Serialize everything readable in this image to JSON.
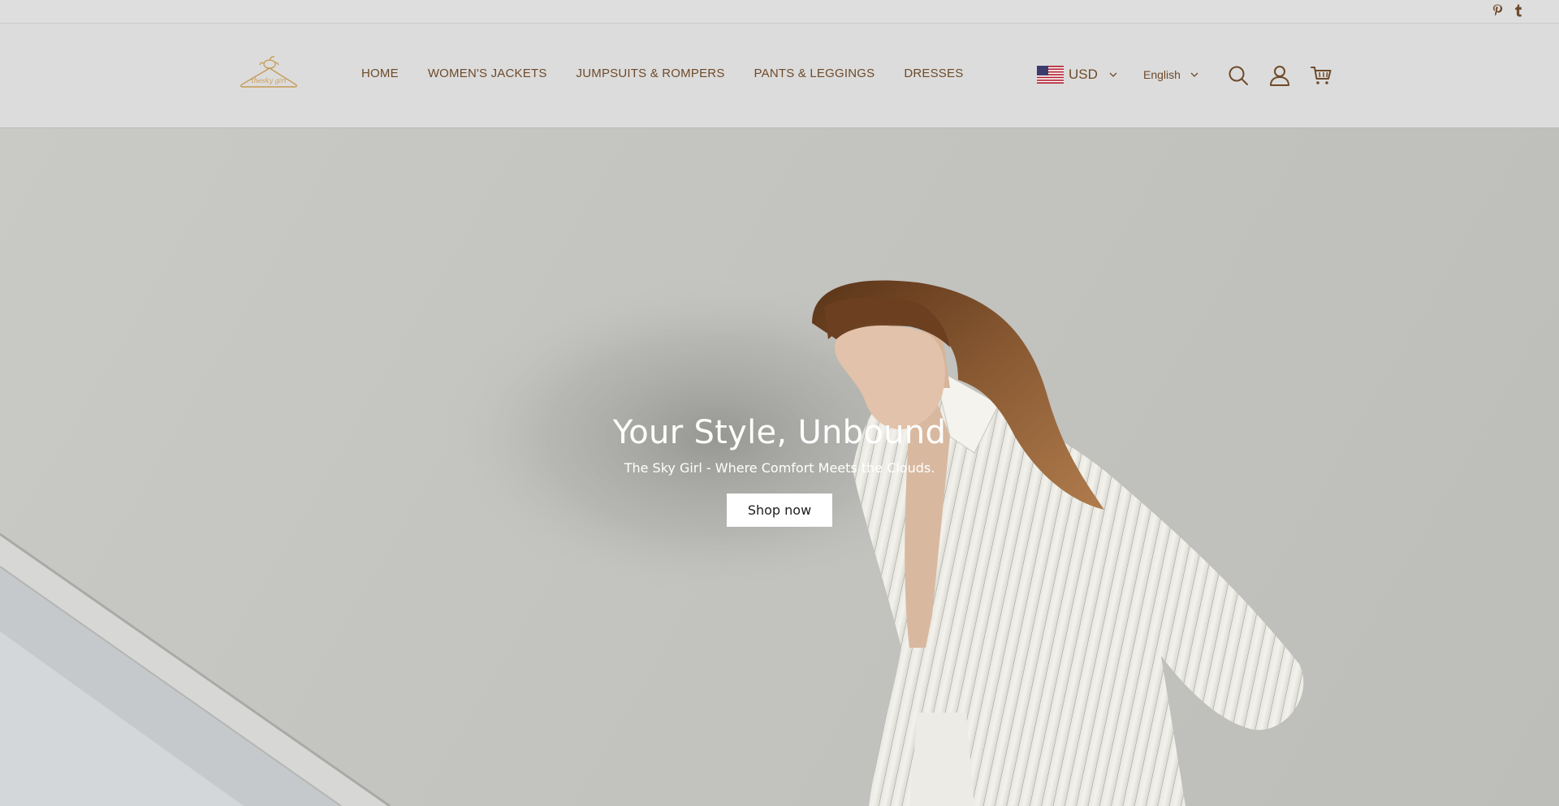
{
  "social": {
    "pinterest_icon": "pinterest-icon",
    "tumblr_icon": "tumblr-icon"
  },
  "header": {
    "logo_icon": "hanger-logo",
    "logo_text": "thesky girl",
    "nav": [
      {
        "label": "HOME"
      },
      {
        "label": "WOMEN'S JACKETS"
      },
      {
        "label": "JUMPSUITS & ROMPERS"
      },
      {
        "label": "PANTS & LEGGINGS"
      },
      {
        "label": "DRESSES"
      }
    ],
    "currency": {
      "label": "USD",
      "flag_icon": "us-flag-icon"
    },
    "language": {
      "label": "English"
    },
    "icons": [
      "search-icon",
      "account-icon",
      "cart-icon"
    ]
  },
  "hero": {
    "title": "Your Style, Unbound",
    "subtitle": "The Sky Girl - Where Comfort Meets the Clouds.",
    "button_label": "Shop now"
  },
  "colors": {
    "accent_brown": "#6e4a2a",
    "logo_gold": "#c79a55",
    "header_bg": "#dcdcdc",
    "hero_text": "#ffffff"
  }
}
